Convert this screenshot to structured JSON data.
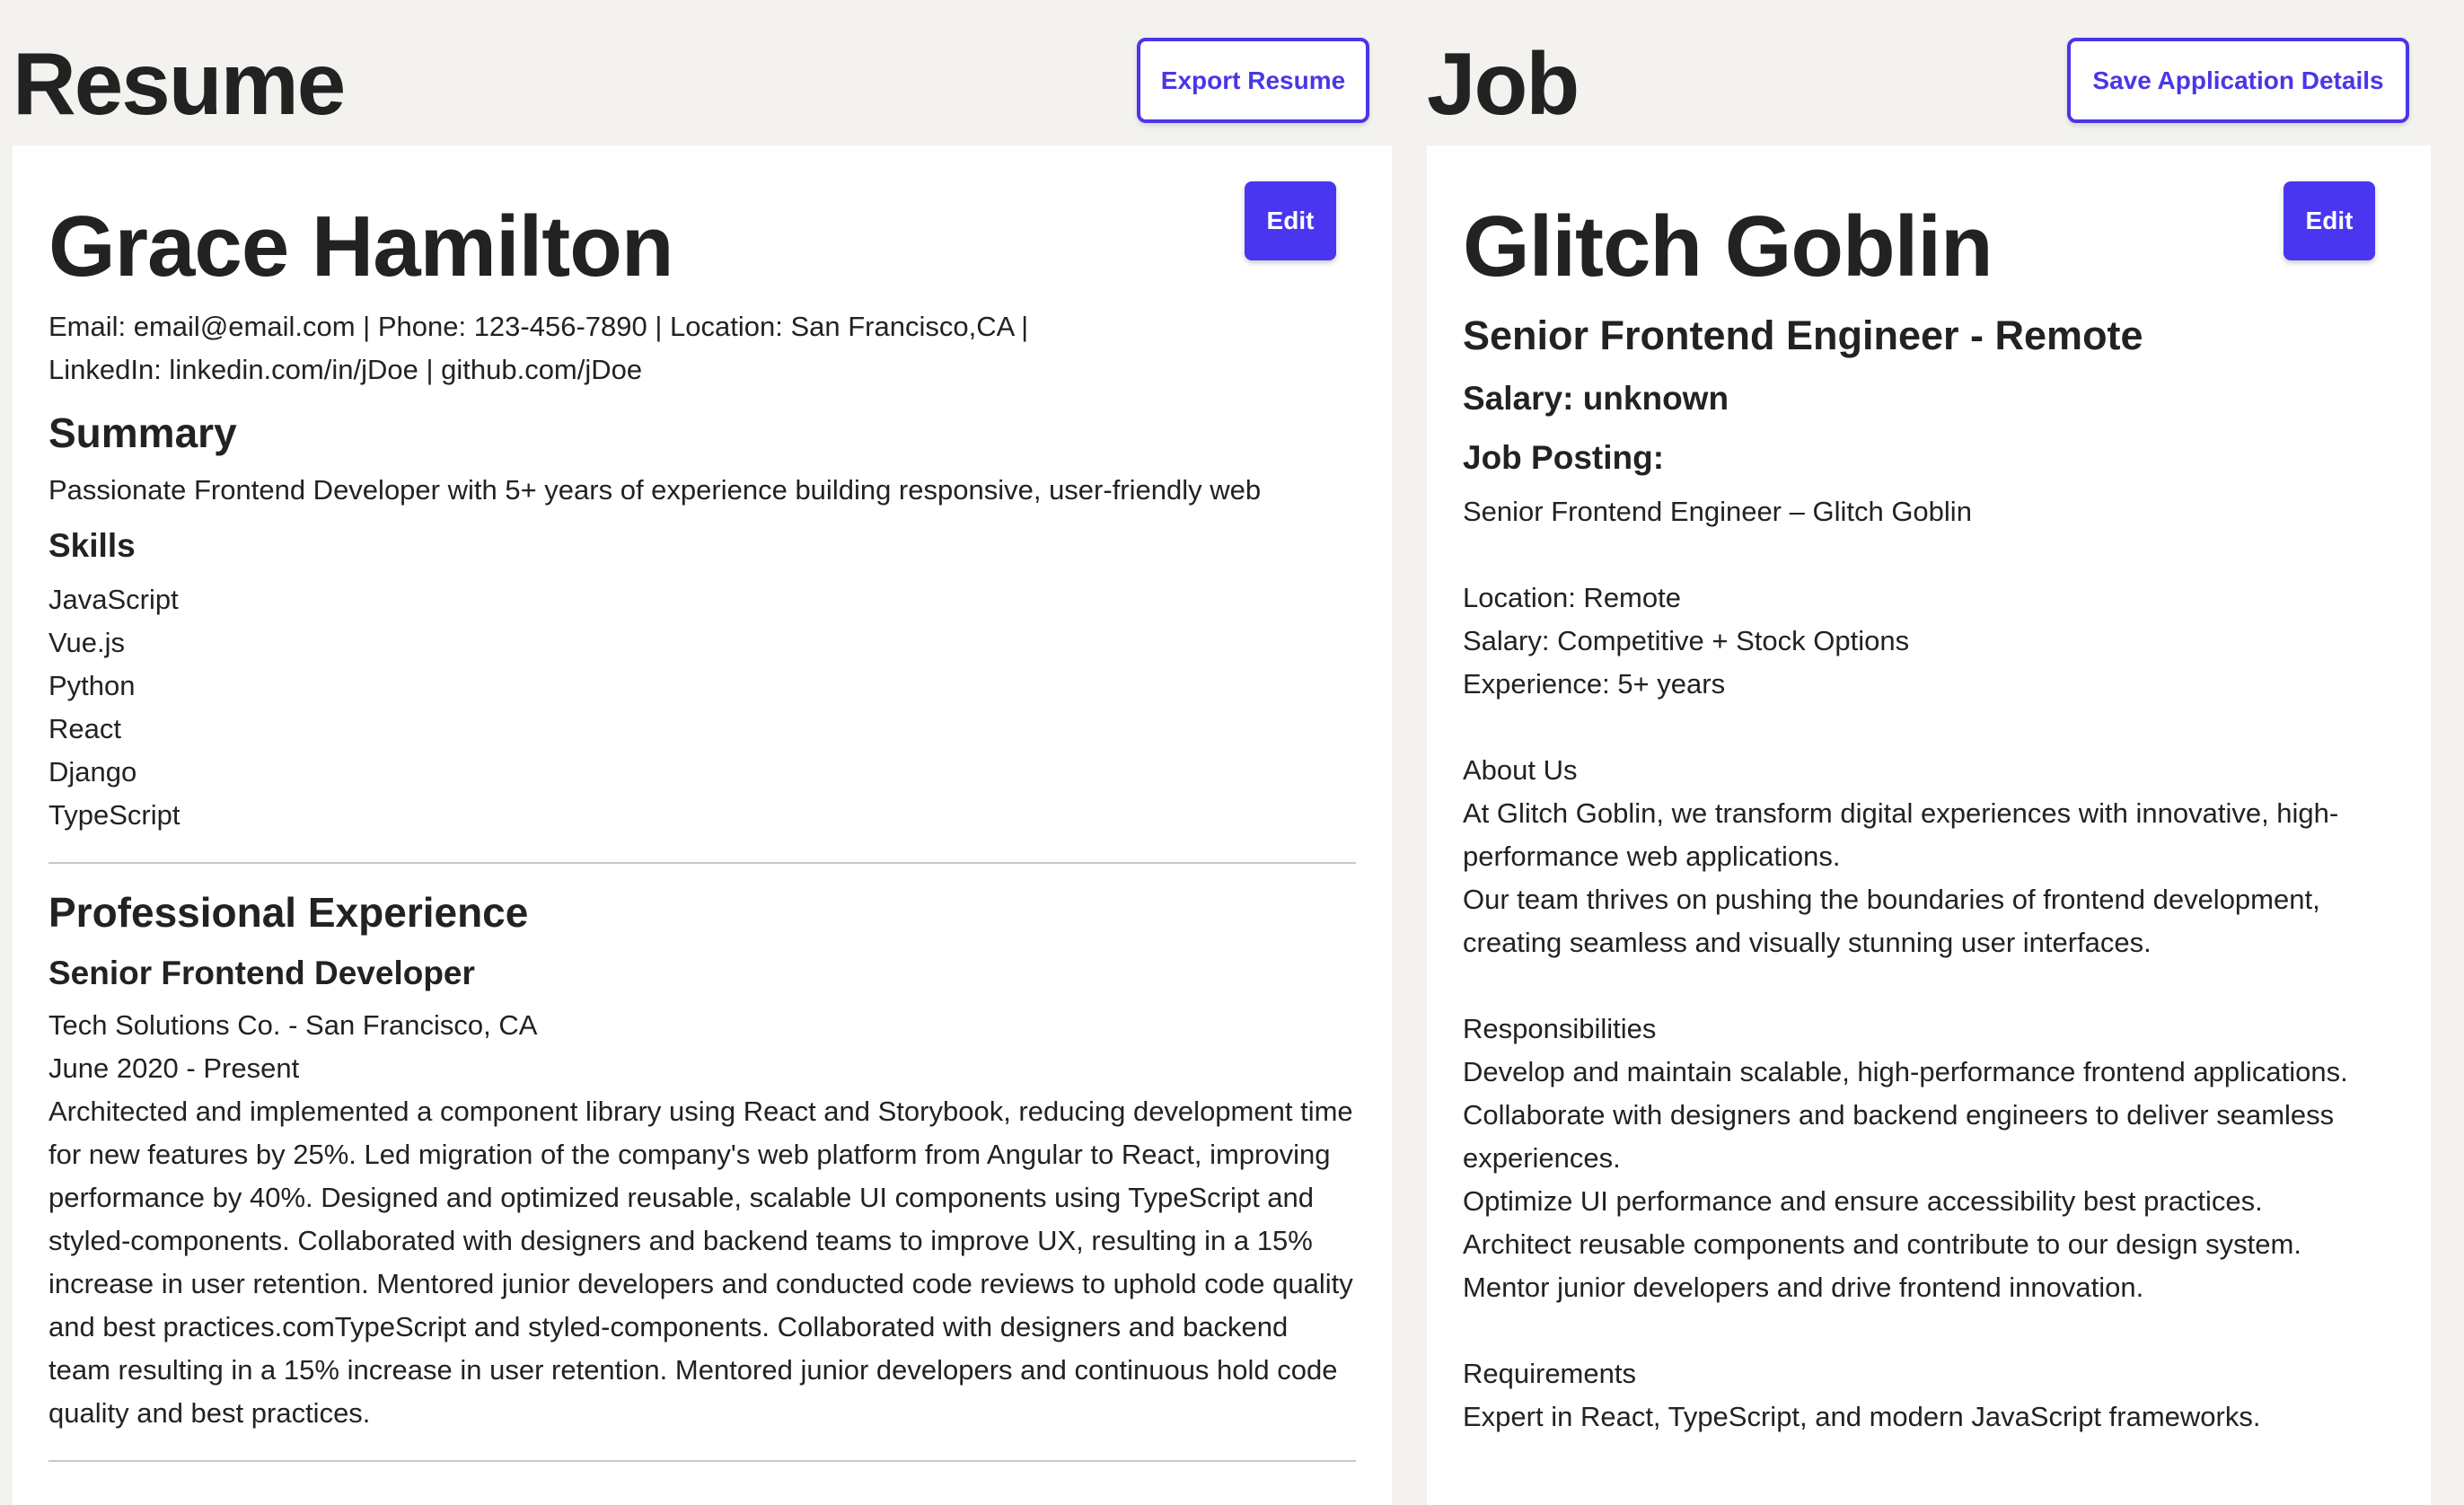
{
  "resume": {
    "title": "Resume",
    "export_label": "Export Resume",
    "edit_label": "Edit",
    "name": "Grace Hamilton",
    "contact_line1": "Email: email@email.com | Phone: 123-456-7890 | Location: San Francisco,CA |",
    "contact_line2": "LinkedIn: linkedin.com/in/jDoe | github.com/jDoe",
    "summary_heading": "Summary",
    "summary_text": "Passionate Frontend Developer with 5+ years of experience building responsive, user-friendly web",
    "skills_heading": "Skills",
    "skills": [
      "JavaScript",
      "Vue.js",
      "Python",
      "React",
      "Django",
      "TypeScript"
    ],
    "experience_heading": "Professional Experience",
    "experience": [
      {
        "role": "Senior Frontend Developer",
        "company": "Tech Solutions Co. - San Francisco, CA",
        "dates": "June 2020 - Present",
        "description": "Architected and implemented a component library using React and Storybook, reducing development time for new features by 25%. Led migration of the company's web platform from Angular to React, improving performance by 40%. Designed and optimized reusable, scalable UI components using TypeScript and styled-components. Collaborated with designers and backend teams to improve UX, resulting in a 15% increase in user retention. Mentored junior developers and conducted code reviews to uphold code quality and best practices.comTypeScript and styled-components. Collaborated with designers and backend team resulting in a 15% increase in user retention. Mentored junior developers and continuous hold code quality and best practices."
      }
    ]
  },
  "job": {
    "title": "Job",
    "save_label": "Save Application Details",
    "edit_label": "Edit",
    "company": "Glitch Goblin",
    "position": "Senior Frontend Engineer - Remote",
    "salary": "Salary: unknown",
    "posting_heading": "Job Posting:",
    "posting_text": "Senior Frontend Engineer – Glitch Goblin\n\nLocation: Remote\nSalary: Competitive + Stock Options\nExperience: 5+ years\n\nAbout Us\nAt Glitch Goblin, we transform digital experiences with innovative, high-performance web applications.\nOur team thrives on pushing the boundaries of frontend development, creating seamless and visually stunning user interfaces.\n\nResponsibilities\nDevelop and maintain scalable, high-performance frontend applications.\nCollaborate with designers and backend engineers to deliver seamless experiences.\nOptimize UI performance and ensure accessibility best practices.\nArchitect reusable components and contribute to our design system.\nMentor junior developers and drive frontend innovation.\n\nRequirements\nExpert in React, TypeScript, and modern JavaScript frameworks."
  },
  "colors": {
    "background": "#f3f2ef",
    "accent": "#4a36f0",
    "text": "#222222"
  }
}
